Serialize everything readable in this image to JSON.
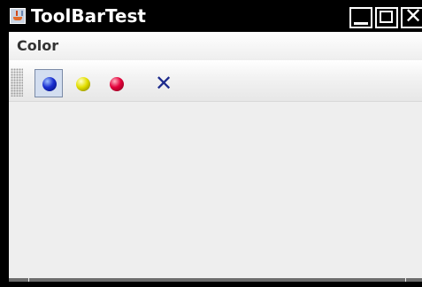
{
  "window": {
    "title": "ToolBarTest",
    "app_icon": "java-cup-icon",
    "controls": {
      "minimize_icon": "minimize-icon",
      "maximize_icon": "maximize-icon",
      "close_icon": "close-icon"
    }
  },
  "menubar": {
    "items": [
      {
        "label": "Color"
      }
    ]
  },
  "toolbar": {
    "buttons": [
      {
        "name": "blue-ball-button",
        "icon": "blue-ball-icon",
        "color": "#1a2fd0",
        "selected": true
      },
      {
        "name": "yellow-ball-button",
        "icon": "yellow-ball-icon",
        "color": "#e3df00",
        "selected": false
      },
      {
        "name": "red-ball-button",
        "icon": "red-ball-icon",
        "color": "#e3003a",
        "selected": false
      },
      {
        "name": "exit-button",
        "icon": "exit-x-icon",
        "glyph": "✕",
        "selected": false
      }
    ]
  },
  "colors": {
    "titlebar_bg": "#000000",
    "title_text": "#ffffff",
    "client_bg": "#eeeeee",
    "selected_button_bg": "#d3def0",
    "exit_icon": "#1c2a8c"
  }
}
